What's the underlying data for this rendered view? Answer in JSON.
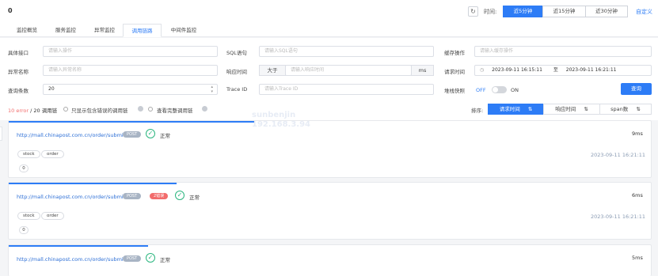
{
  "header": {
    "count": "0",
    "refresh_icon": "refresh-icon",
    "time_label": "时间:",
    "time_options": [
      "近5分钟",
      "近15分钟",
      "近30分钟"
    ],
    "custom": "自定义"
  },
  "tabs": [
    "监控概览",
    "服务监控",
    "异常监控",
    "调用链路",
    "中间件监控"
  ],
  "filters": {
    "api_label": "具体接口",
    "api_placeholder": "请输入操作",
    "sql_label": "SQL语句",
    "sql_placeholder": "请输入SQL语句",
    "cache_label": "缓存操作",
    "cache_placeholder": "请输入缓存操作",
    "exc_label": "异常名称",
    "exc_placeholder": "请输入异常名称",
    "resp_label": "响应时间",
    "resp_op": "大于",
    "resp_placeholder": "请输入响应时间",
    "resp_unit": "ms",
    "req_label": "请求时间",
    "req_start": "2023-09-11 16:15:11",
    "req_sep": "至",
    "req_end": "2023-09-11 16:21:11",
    "count_label": "查询条数",
    "count_value": "20",
    "trace_label": "Trace ID",
    "trace_placeholder": "请输入Trace ID",
    "stack_label": "堆栈快照",
    "stack_off": "OFF",
    "stack_on": "ON",
    "query_button": "查询"
  },
  "status": {
    "error_count": "10 error",
    "summary": " / 20 调用链",
    "only_error": "只显示包含错误的调用链",
    "view_full": "查看完整调用链",
    "sort_label": "排序:",
    "sort_options": [
      "请求时间",
      "响应时间",
      "span数"
    ]
  },
  "watermark": [
    "sunbenjin",
    "192.168.3.94"
  ],
  "cards": [
    {
      "url": "http://mall.chinapost.com.cn/order/submit",
      "tag": "POST",
      "status": "正常",
      "chips": [
        "stock",
        "order"
      ],
      "count": "0",
      "duration": "9ms",
      "time": "2023-09-11 16:21:11",
      "error_tag": ""
    },
    {
      "url": "http://mall.chinapost.com.cn/order/submit",
      "tag": "POST",
      "status": "正常",
      "chips": [
        "stock",
        "order"
      ],
      "count": "0",
      "duration": "6ms",
      "time": "2023-09-11 16:21:11",
      "error_tag": "2错误"
    },
    {
      "url": "http://mall.chinapost.com.cn/order/submit",
      "tag": "POST",
      "status": "正常",
      "chips": [],
      "count": "",
      "duration": "5ms",
      "time": "",
      "error_tag": ""
    }
  ],
  "colors": {
    "accent": "#2d7cf6",
    "ok": "#2bb67f",
    "error": "#f26c6c"
  }
}
